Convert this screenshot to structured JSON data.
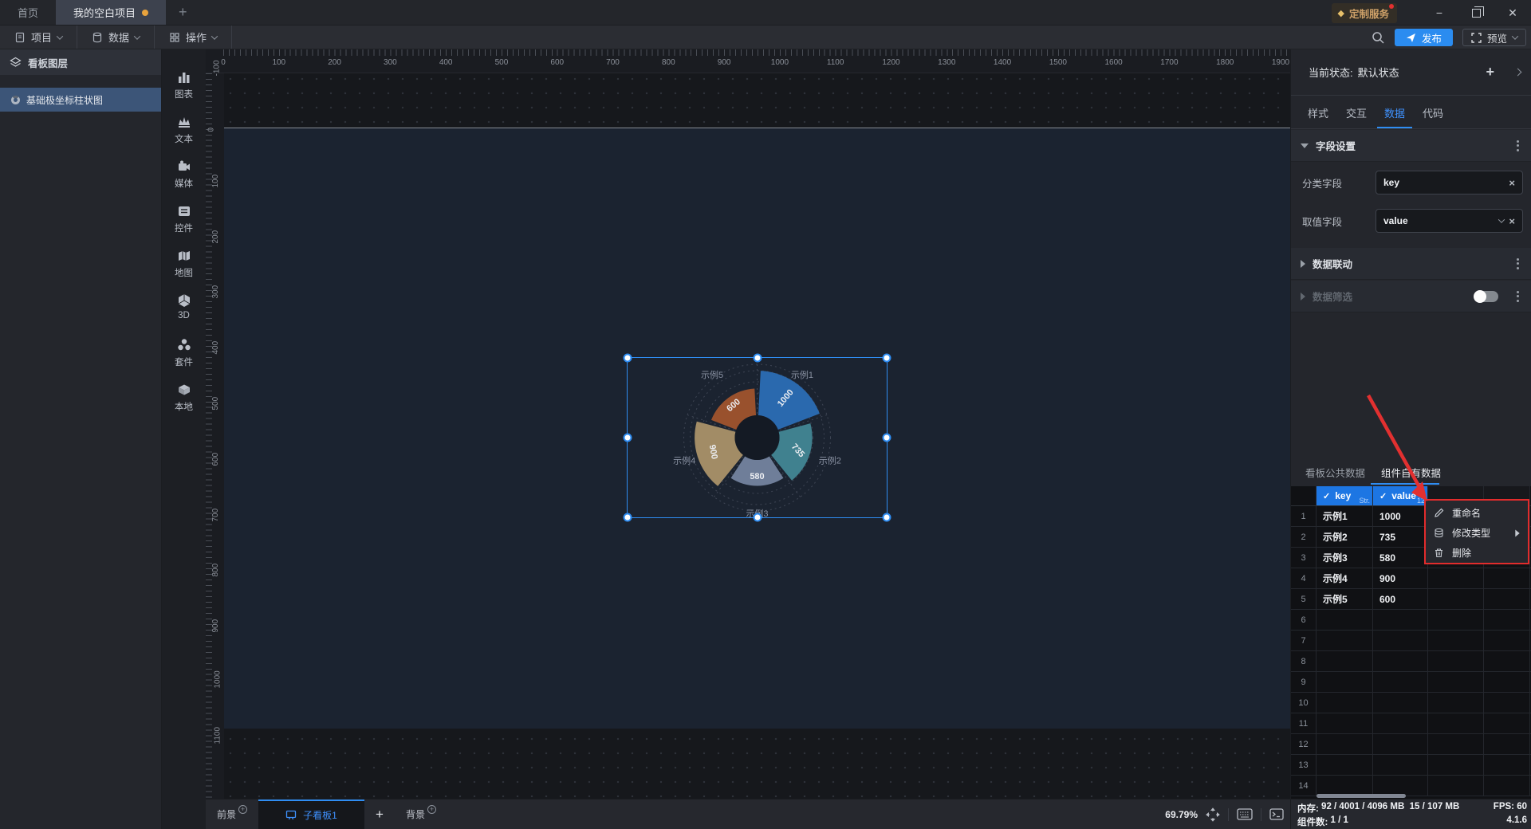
{
  "title_bar": {
    "tabs": [
      {
        "label": "首页",
        "active": false
      },
      {
        "label": "我的空白项目",
        "active": true,
        "modified": true
      }
    ],
    "new_tab": "+",
    "service_badge": "定制服务",
    "window_controls": {
      "minimize": "−",
      "restore": "restore",
      "close": "✕"
    }
  },
  "menubar": {
    "menus": [
      {
        "label": "项目"
      },
      {
        "label": "数据"
      },
      {
        "label": "操作"
      }
    ],
    "publish_label": "发布",
    "preview_label": "预览"
  },
  "layers_panel": {
    "title": "看板图层",
    "items": [
      {
        "label": "基础极坐标柱状图",
        "selected": true
      }
    ]
  },
  "component_rail": {
    "items": [
      "图表",
      "文本",
      "媒体",
      "控件",
      "地图",
      "3D",
      "套件",
      "本地"
    ]
  },
  "canvas": {
    "h_ruler_labels": [
      0,
      100,
      200,
      300,
      400,
      500,
      600,
      700,
      800,
      900,
      1000,
      1100,
      1200,
      1300,
      1400,
      1500,
      1600,
      1700,
      1800,
      1900
    ],
    "v_ruler_labels": [
      -100,
      0,
      100,
      200,
      300,
      400,
      500,
      600,
      700,
      800,
      900,
      1000,
      1100
    ],
    "zoom_scale": 0.6979
  },
  "chart_data": {
    "type": "polar_bar",
    "title": "基础极坐标柱状图",
    "categories": [
      "示例1",
      "示例2",
      "示例3",
      "示例4",
      "示例5"
    ],
    "values": [
      1000,
      735,
      580,
      900,
      600
    ],
    "series_colors": [
      "#2a69ae",
      "#40818f",
      "#6f7e99",
      "#a28c66",
      "#99512d"
    ],
    "rmax": 1000,
    "grid": "dashed-rings",
    "label_color": "#8b93a4",
    "value_label_color": "#eceef2"
  },
  "properties_panel": {
    "state_label": "当前状态:",
    "state_value": "默认状态",
    "tabs": [
      "样式",
      "交互",
      "数据",
      "代码"
    ],
    "active_tab": "数据",
    "field_settings": {
      "title": "字段设置",
      "category_label": "分类字段",
      "category_value": "key",
      "value_label": "取值字段",
      "value_value": "value"
    },
    "data_linkage_label": "数据联动",
    "data_filter_label": "数据筛选",
    "data_filter_enabled": false
  },
  "data_panel": {
    "tabs": [
      "看板公共数据",
      "组件自有数据"
    ],
    "active_tab": "组件自有数据",
    "columns": [
      {
        "name": "key",
        "type_label": "Str."
      },
      {
        "name": "value",
        "type_label": "12"
      }
    ],
    "rows": [
      {
        "key": "示例1",
        "value": "1000"
      },
      {
        "key": "示例2",
        "value": "735"
      },
      {
        "key": "示例3",
        "value": "580"
      },
      {
        "key": "示例4",
        "value": "900"
      },
      {
        "key": "示例5",
        "value": "600"
      }
    ],
    "visible_row_numbers": 14
  },
  "context_menu": {
    "items": [
      {
        "label": "重命名",
        "icon": "pencil-icon",
        "submenu": false
      },
      {
        "label": "修改类型",
        "icon": "type-icon",
        "submenu": true
      },
      {
        "label": "删除",
        "icon": "trash-icon",
        "submenu": false
      }
    ]
  },
  "bottom_bar": {
    "foreground_label": "前景",
    "board_tab_label": "子看板1",
    "add_label": "+",
    "background_label": "背景",
    "zoom": "69.79%"
  },
  "status_bar": {
    "memory_label": "内存:",
    "memory_value": "92 / 4001 / 4096 MB  15 / 107 MB",
    "fps_label": "FPS:",
    "fps_value": "60",
    "components_label": "组件数:",
    "components_value": "1 / 1",
    "version": "4.1.6"
  }
}
